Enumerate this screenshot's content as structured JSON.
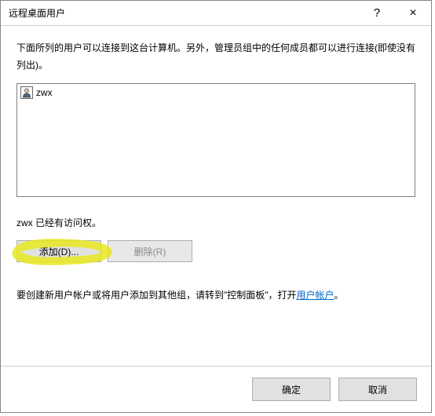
{
  "titlebar": {
    "title": "远程桌面用户",
    "help": "?",
    "close": "×"
  },
  "description": "下面所列的用户可以连接到这台计算机。另外，管理员组中的任何成员都可以进行连接(即使没有列出)。",
  "users": [
    {
      "name": "zwx",
      "icon": "👤"
    }
  ],
  "access_text": "zwx 已经有访问权。",
  "buttons": {
    "add": "添加(D)...",
    "remove": "删除(R)"
  },
  "link_prefix": "要创建新用户帐户或将用户添加到其他组，请转到\"控制面板\"，打开",
  "link_label": "用户帐户",
  "link_suffix": "。",
  "footer": {
    "ok": "确定",
    "cancel": "取消"
  }
}
